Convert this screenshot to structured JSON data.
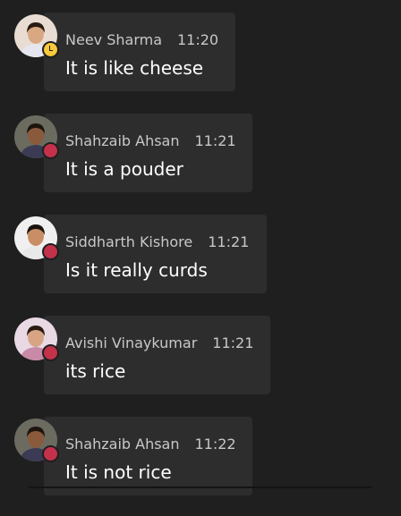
{
  "messages": [
    {
      "name": "Neev Sharma",
      "time": "11:20",
      "text": "It is like cheese",
      "status": "away",
      "avatar_colors": {
        "bg": "#e9ddd3",
        "skin": "#d9a882",
        "hair": "#2a1b14",
        "shirt": "#e6e6f0"
      }
    },
    {
      "name": "Shahzaib Ahsan",
      "time": "11:21",
      "text": "It is a pouder",
      "status": "dnd",
      "avatar_colors": {
        "bg": "#6b6b5f",
        "skin": "#8a5a3c",
        "hair": "#1e140e",
        "shirt": "#3b3b55"
      }
    },
    {
      "name": "Siddharth Kishore",
      "time": "11:21",
      "text": "Is it really curds",
      "status": "dnd",
      "avatar_colors": {
        "bg": "#f0f0f0",
        "skin": "#c98e66",
        "hair": "#1a120d",
        "shirt": "#e9e9e9"
      }
    },
    {
      "name": "Avishi Vinaykumar",
      "time": "11:21",
      "text": "its rice",
      "status": "dnd",
      "avatar_colors": {
        "bg": "#e9d9e4",
        "skin": "#d7a584",
        "hair": "#2b1a12",
        "shirt": "#c98aa8"
      }
    },
    {
      "name": "Shahzaib Ahsan",
      "time": "11:22",
      "text": "It is not rice",
      "status": "dnd",
      "avatar_colors": {
        "bg": "#6b6b5f",
        "skin": "#8a5a3c",
        "hair": "#1e140e",
        "shirt": "#3b3b55"
      }
    }
  ],
  "colors": {
    "background": "#1f1f1f",
    "bubble": "#2d2d2d",
    "away": "#f8c93a",
    "dnd": "#c4314b"
  }
}
